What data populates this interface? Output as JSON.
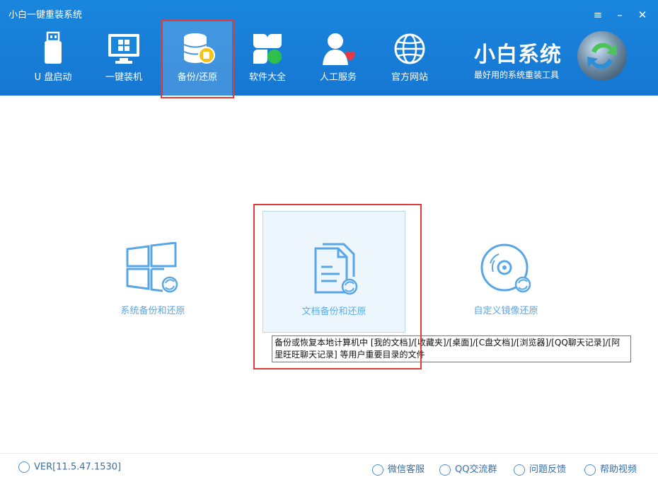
{
  "window": {
    "title": "小白一键重装系统",
    "menu_icon": "hamburger-icon",
    "min_icon": "minimize-icon",
    "close_icon": "close-icon"
  },
  "nav": [
    {
      "label": "U 盘启动",
      "icon": "usb-icon"
    },
    {
      "label": "一键装机",
      "icon": "monitor-windows-icon"
    },
    {
      "label": "备份/还原",
      "icon": "database-icon"
    },
    {
      "label": "软件大全",
      "icon": "apps-icon"
    },
    {
      "label": "人工服务",
      "icon": "person-heart-icon"
    },
    {
      "label": "官方网站",
      "icon": "globe-icon"
    }
  ],
  "brand": {
    "name": "小白系统",
    "tagline": "最好用的系统重装工具"
  },
  "options": [
    {
      "label": "系统备份和还原",
      "icon": "windows-restore-icon"
    },
    {
      "label": "文档备份和还原",
      "icon": "document-restore-icon"
    },
    {
      "label": "自定义镜像还原",
      "icon": "disc-restore-icon"
    }
  ],
  "tooltip": "备份或恢复本地计算机中 [我的文档]/[收藏夹]/[桌面]/[C盘文档]/[浏览器]/[QQ聊天记录]/[阿里旺旺聊天记录] 等用户重要目录的文件",
  "footer": {
    "version": "VER[11.5.47.1530]",
    "links": [
      "微信客服",
      "QQ交流群",
      "问题反馈",
      "帮助视频"
    ]
  },
  "colors": {
    "header": "#1677d2",
    "accent": "#58a6e6",
    "highlight": "#e23b3b"
  }
}
